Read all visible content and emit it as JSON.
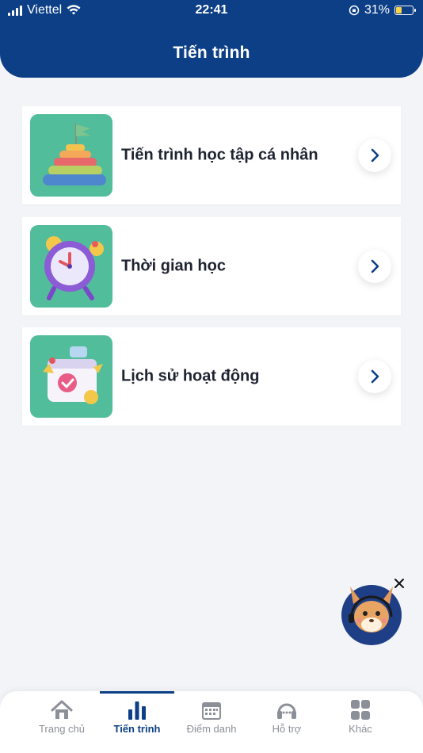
{
  "status_bar": {
    "carrier": "Viettel",
    "time": "22:41",
    "battery": "31%"
  },
  "header": {
    "title": "Tiến trình"
  },
  "menu": [
    {
      "label": "Tiến trình học tập cá nhân",
      "icon": "pyramid-flag-icon"
    },
    {
      "label": "Thời gian học",
      "icon": "alarm-clock-icon"
    },
    {
      "label": "Lịch sử hoạt động",
      "icon": "calendar-activity-icon"
    }
  ],
  "bottom_nav": [
    {
      "label": "Trang chủ",
      "icon": "home-icon",
      "active": false
    },
    {
      "label": "Tiến trình",
      "icon": "bar-chart-icon",
      "active": true
    },
    {
      "label": "Điểm danh",
      "icon": "calendar-icon",
      "active": false
    },
    {
      "label": "Hỗ trợ",
      "icon": "headset-icon",
      "active": false
    },
    {
      "label": "Khác",
      "icon": "grid-icon",
      "active": false
    }
  ],
  "colors": {
    "primary": "#0c3f86",
    "thumb_bg": "#52bd9a",
    "page_bg": "#f2f4f7",
    "inactive": "#8b8f97"
  }
}
